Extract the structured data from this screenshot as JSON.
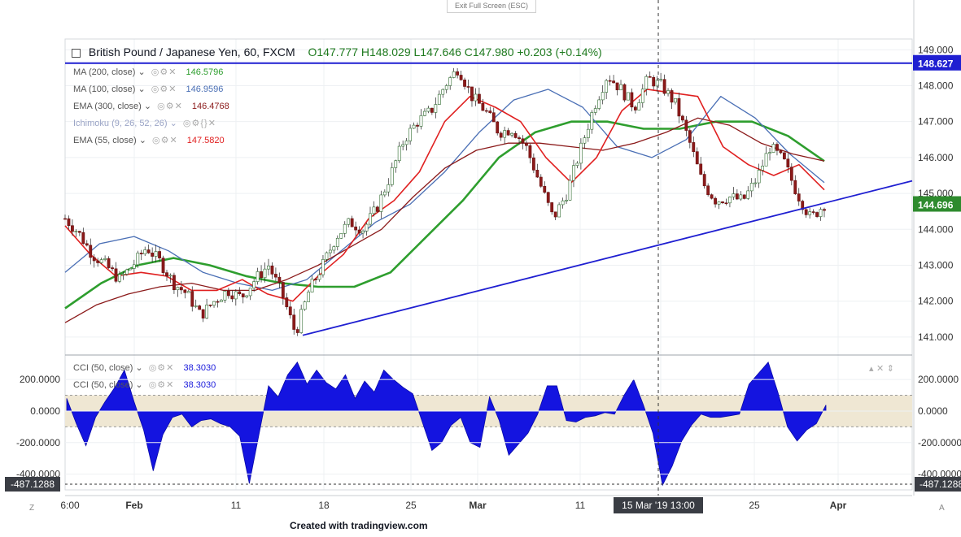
{
  "toolbar": {
    "exit_fullscreen": "Exit Full Screen (ESC)"
  },
  "header": {
    "symbol": "British Pound / Japanese Yen, 60, FXCM",
    "ohlc": "O147.777  H148.029  L147.646  C147.980  +0.203 (+0.14%)"
  },
  "indicators": [
    {
      "label": "MA (200, close)",
      "value": "146.5796",
      "color": "#2e9e2e"
    },
    {
      "label": "MA (100, close)",
      "value": "146.9596",
      "color": "#4a6fb5"
    },
    {
      "label": "EMA (300, close)",
      "value": "146.4768",
      "color": "#8b1a1a"
    },
    {
      "label": "Ichimoku (9, 26, 52, 26)",
      "value": "",
      "color": "#9aa4c6"
    },
    {
      "label": "EMA (55, close)",
      "value": "147.5820",
      "color": "#e02020"
    }
  ],
  "cci_legend": [
    {
      "label": "CCI (50, close)",
      "value": "38.3030"
    },
    {
      "label": "CCI (50, close)",
      "value": "38.3030"
    }
  ],
  "footer": "Created with tradingview.com",
  "chart_data": [
    {
      "type": "line",
      "title": "British Pound / Japanese Yen, 60, FXCM",
      "ylim": [
        140.5,
        149.3
      ],
      "yticks": [
        "141.000",
        "142.000",
        "143.000",
        "144.000",
        "145.000",
        "146.000",
        "147.000",
        "148.000",
        "149.000"
      ],
      "xticks": [
        "6:00",
        "Feb",
        "11",
        "18",
        "25",
        "Mar",
        "11",
        "15 Mar '19  13:00",
        "25",
        "Apr"
      ],
      "last_price": "144.696",
      "hline_label": "148.627",
      "trendline": {
        "from": [
          141.05,
          "16 Feb"
        ],
        "to": [
          145.35,
          "Apr"
        ]
      },
      "price_path": [
        144.3,
        143.9,
        143.3,
        143.0,
        142.6,
        143.0,
        143.5,
        143.1,
        142.5,
        142.2,
        141.6,
        142.0,
        142.3,
        142.1,
        142.6,
        143.0,
        142.2,
        141.1,
        142.3,
        143.0,
        143.8,
        144.2,
        144.0,
        144.6,
        145.5,
        146.5,
        147.0,
        147.3,
        148.0,
        148.5,
        147.7,
        147.3,
        146.7,
        146.8,
        146.3,
        145.3,
        144.3,
        145.0,
        146.2,
        147.4,
        148.3,
        147.9,
        147.4,
        148.2,
        148.0,
        147.5,
        146.5,
        145.3,
        144.8,
        144.9,
        144.8,
        145.4,
        146.3,
        145.9,
        145.0,
        144.3,
        144.7
      ],
      "series": [
        {
          "name": "MA (200, close)",
          "color": "#2e9e2e",
          "values": [
            141.8,
            142.5,
            143.0,
            143.2,
            143.0,
            142.7,
            142.5,
            142.4,
            142.4,
            142.8,
            143.8,
            144.8,
            146.0,
            146.7,
            147.0,
            147.0,
            146.8,
            146.8,
            147.0,
            147.0,
            146.6,
            145.9
          ]
        },
        {
          "name": "MA (100, close)",
          "color": "#4a6fb5",
          "values": [
            142.8,
            143.6,
            143.8,
            143.4,
            142.8,
            142.5,
            142.3,
            142.6,
            143.4,
            144.2,
            144.7,
            145.6,
            146.7,
            147.6,
            147.9,
            147.4,
            146.3,
            146.0,
            146.5,
            147.7,
            147.1,
            146.1,
            145.3
          ]
        },
        {
          "name": "EMA (300, close)",
          "color": "#8b1a1a",
          "values": [
            141.4,
            141.9,
            142.2,
            142.4,
            142.5,
            142.3,
            142.3,
            142.6,
            143.0,
            143.5,
            144.0,
            144.9,
            145.7,
            146.2,
            146.4,
            146.4,
            146.3,
            146.2,
            146.4,
            146.7,
            147.1,
            146.9,
            146.4,
            146.1,
            145.9
          ]
        },
        {
          "name": "EMA (55, close)",
          "color": "#e02020",
          "values": [
            144.1,
            143.3,
            142.7,
            142.8,
            142.7,
            142.3,
            142.3,
            142.6,
            142.2,
            142.0,
            142.7,
            143.3,
            144.3,
            144.8,
            145.6,
            147.0,
            147.7,
            147.4,
            147.0,
            146.0,
            145.3,
            146.0,
            147.3,
            147.9,
            147.8,
            147.7,
            146.3,
            145.8,
            145.5,
            145.8,
            145.1
          ]
        }
      ]
    },
    {
      "type": "area",
      "title": "CCI (50, close)",
      "ylim": [
        -500,
        350
      ],
      "yticks": [
        "200.0000",
        "0.0000",
        "-200.0000",
        "-400.0000"
      ],
      "band": [
        -100,
        100
      ],
      "low_marker": "-487.1288",
      "values": [
        80,
        -80,
        -220,
        -40,
        60,
        150,
        260,
        60,
        -120,
        -380,
        -150,
        -40,
        -20,
        -100,
        -60,
        -50,
        -80,
        -100,
        -160,
        -460,
        -150,
        160,
        90,
        230,
        310,
        170,
        260,
        180,
        140,
        230,
        80,
        190,
        120,
        260,
        200,
        150,
        110,
        -70,
        -250,
        -200,
        -90,
        -40,
        -200,
        -230,
        90,
        -60,
        -280,
        -210,
        -140,
        -20,
        160,
        160,
        -60,
        -70,
        -40,
        -30,
        -10,
        -20,
        100,
        200,
        40,
        -140,
        -470,
        -350,
        -190,
        -90,
        -20,
        -40,
        -40,
        -30,
        -20,
        170,
        240,
        310,
        120,
        -100,
        -190,
        -120,
        -80,
        38
      ]
    }
  ]
}
